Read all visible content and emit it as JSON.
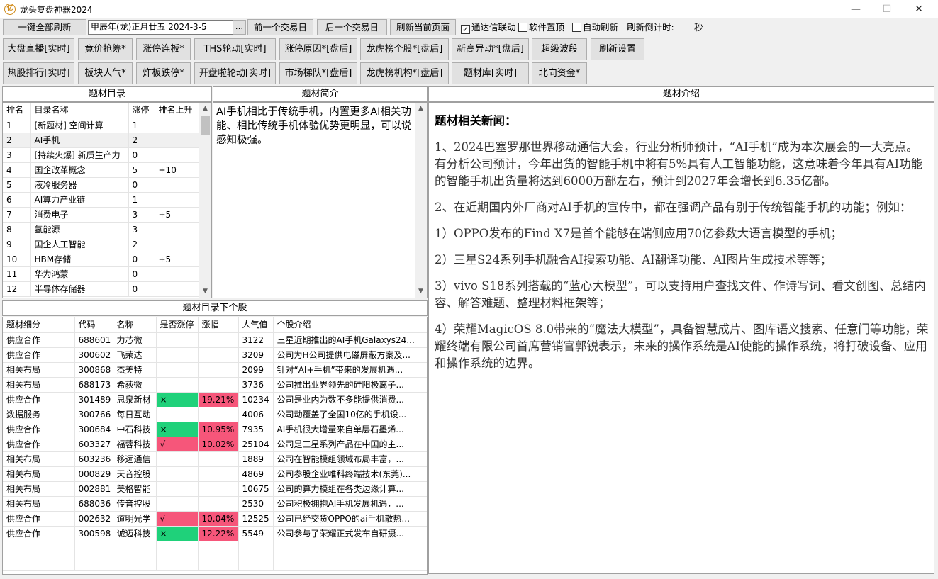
{
  "window": {
    "title": "龙头复盘神器2024",
    "app_icon": "亿",
    "minimize": "—",
    "maximize": "☐",
    "close": "✕"
  },
  "toolbar": {
    "refresh_all": "一键全部刷新",
    "date_value": "甲辰年(龙)正月廿五  2024-3-5",
    "date_picker": "...",
    "prev_day": "前一个交易日",
    "next_day": "后一个交易日",
    "refresh_page": "刷新当前页面",
    "tdx_link": "通达信联动",
    "pin_top": "软件置顶",
    "auto_refresh": "自动刷新",
    "countdown_label": "刷新倒计时:",
    "countdown_unit": "秒"
  },
  "nav_row1": [
    "大盘直播[实时]",
    "竟价抢筹*",
    "涨停连板*",
    "THS轮动[实时]",
    "涨停原因*[盘后]",
    "龙虎榜个股*[盘后]",
    "新高异动*[盘后]",
    "超级波段",
    "刷新设置"
  ],
  "nav_row2": [
    "热股排行[实时]",
    "板块人气*",
    "炸板跌停*",
    "开盘啦轮动[实时]",
    "市场梯队*[盘后]",
    "龙虎榜机构*[盘后]",
    "题材库[实时]",
    "北向资金*"
  ],
  "catalog": {
    "title": "题材目录",
    "headers": [
      "排名",
      "目录名称",
      "涨停",
      "排名上升"
    ],
    "rows": [
      [
        "1",
        " [新题材] 空间计算",
        "1",
        ""
      ],
      [
        "2",
        "AI手机",
        "2",
        ""
      ],
      [
        "3",
        " [持续火爆] 新质生产力",
        "0",
        ""
      ],
      [
        "4",
        "国企改革概念",
        "5",
        "+10"
      ],
      [
        "5",
        "液冷服务器",
        "0",
        ""
      ],
      [
        "6",
        "AI算力产业链",
        "1",
        ""
      ],
      [
        "7",
        "消费电子",
        "3",
        "+5"
      ],
      [
        "8",
        "氢能源",
        "3",
        ""
      ],
      [
        "9",
        "国企人工智能",
        "2",
        ""
      ],
      [
        "10",
        "HBM存储",
        "0",
        "+5"
      ],
      [
        "11",
        "华为鸿蒙",
        "0",
        ""
      ],
      [
        "12",
        "半导体存储器",
        "0",
        ""
      ]
    ]
  },
  "summary": {
    "title": "题材简介",
    "text": "AI手机相比于传统手机，内置更多AI相关功能、相比传统手机体验优势更明显，可以说感知极强。"
  },
  "intro": {
    "title": "题材介绍",
    "news_title": "题材相关新闻：",
    "paragraphs": [
      "1、2024巴塞罗那世界移动通信大会，行业分析师预计，“AI手机”成为本次展会的一大亮点。有分析公司预计，今年出货的智能手机中将有5%具有人工智能功能，这意味着今年具有AI功能的智能手机出货量将达到6000万部左右，预计到2027年会增长到6.35亿部。",
      "2、在近期国内外厂商对AI手机的宣传中，都在强调产品有别于传统智能手机的功能；例如：",
      "1）OPPO发布的Find X7是首个能够在端侧应用70亿参数大语言模型的手机；",
      "2）三星S24系列手机融合AI搜索功能、AI翻译功能、AI图片生成技术等等；",
      "3）vivo S18系列搭载的“蓝心大模型”，可以支持用户查找文件、作诗写词、看文创图、总结内容、解答难题、整理材料框架等；",
      "4）荣耀MagicOS 8.0带来的“魔法大模型”，具备智慧成片、图库语义搜索、任意门等功能，荣耀终端有限公司首席营销官郭锐表示，未来的操作系统是AI使能的操作系统，将打破设备、应用和操作系统的边界。"
    ]
  },
  "stocks": {
    "title": "题材目录下个股",
    "headers": [
      "题材细分",
      "代码",
      "名称",
      "是否涨停",
      "涨幅",
      "人气值",
      "个股介绍"
    ],
    "rows": [
      {
        "cells": [
          "供应合作",
          "688601",
          "力芯微",
          "",
          "",
          "3122",
          "三星近期推出的AI手机Galaxys24..."
        ],
        "limit_color": "",
        "change_color": ""
      },
      {
        "cells": [
          "供应合作",
          "300602",
          "飞荣达",
          "",
          "",
          "3209",
          "公司为H公司提供电磁屏蔽方案及..."
        ],
        "limit_color": "",
        "change_color": ""
      },
      {
        "cells": [
          "相关布局",
          "300868",
          "杰美特",
          "",
          "",
          "2099",
          "针对“AI+手机”带来的发展机遇..."
        ],
        "limit_color": "",
        "change_color": ""
      },
      {
        "cells": [
          "相关布局",
          "688173",
          "希荻微",
          "",
          "",
          "3736",
          "公司推出业界领先的硅阳极离子..."
        ],
        "limit_color": "",
        "change_color": ""
      },
      {
        "cells": [
          "供应合作",
          "301489",
          "思泉新材",
          "×",
          "19.21%",
          "10234",
          "公司是业内为数不多能提供消费..."
        ],
        "limit_color": "green",
        "change_color": "pink"
      },
      {
        "cells": [
          "数据服务",
          "300766",
          "每日互动",
          "",
          "",
          "4006",
          "公司动覆盖了全国10亿的手机设..."
        ],
        "limit_color": "",
        "change_color": ""
      },
      {
        "cells": [
          "供应合作",
          "300684",
          "中石科技",
          "×",
          "10.95%",
          "7935",
          "AI手机很大增量来自单层石墨烯..."
        ],
        "limit_color": "green",
        "change_color": "pink"
      },
      {
        "cells": [
          "供应合作",
          "603327",
          "福蓉科技",
          "√",
          "10.02%",
          "25104",
          "公司是三星系列产品在中国的主..."
        ],
        "limit_color": "pink",
        "change_color": "pink"
      },
      {
        "cells": [
          "相关布局",
          "603236",
          "移远通信",
          "",
          "",
          "1889",
          "公司在智能模组领域布局丰富，..."
        ],
        "limit_color": "",
        "change_color": ""
      },
      {
        "cells": [
          "相关布局",
          "000829",
          "天音控股",
          "",
          "",
          "4869",
          "公司参股企业唯科终端技术(东莞)..."
        ],
        "limit_color": "",
        "change_color": ""
      },
      {
        "cells": [
          "相关布局",
          "002881",
          "美格智能",
          "",
          "",
          "10675",
          "公司的算力模组在各类边缘计算..."
        ],
        "limit_color": "",
        "change_color": ""
      },
      {
        "cells": [
          "相关布局",
          "688036",
          "传音控股",
          "",
          "",
          "2530",
          "公司积极拥抱AI手机发展机遇，..."
        ],
        "limit_color": "",
        "change_color": ""
      },
      {
        "cells": [
          "供应合作",
          "002632",
          "道明光学",
          "√",
          "10.04%",
          "12525",
          "公司已经交货OPPO的ai手机散热..."
        ],
        "limit_color": "pink",
        "change_color": "pink"
      },
      {
        "cells": [
          "供应合作",
          "300598",
          "诚迈科技",
          "×",
          "12.22%",
          "5549",
          "公司参与了荣耀正式发布自研摄..."
        ],
        "limit_color": "green",
        "change_color": "pink"
      }
    ]
  },
  "colors": {
    "green": "#1fd17a",
    "pink": "#f6567a"
  },
  "icons": {
    "scroll_up": "▲",
    "scroll_down": "▼",
    "check": "✓"
  }
}
